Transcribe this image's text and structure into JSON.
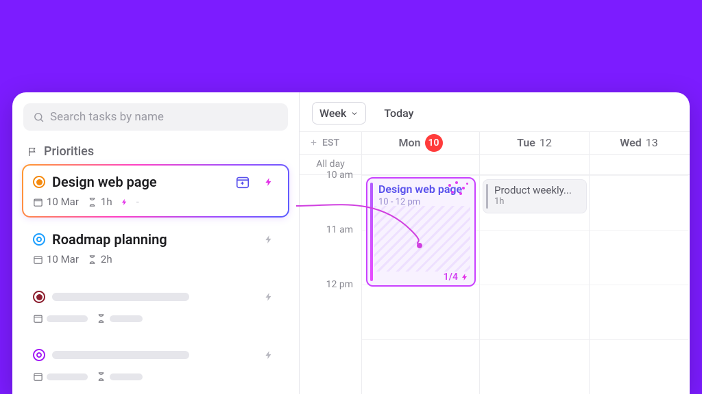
{
  "search": {
    "placeholder": "Search tasks by name"
  },
  "sidebar": {
    "section_title": "Priorities",
    "tasks": [
      {
        "title": "Design web page",
        "date": "10 Mar",
        "duration": "1h"
      },
      {
        "title": "Roadmap planning",
        "date": "10 Mar",
        "duration": "2h"
      }
    ]
  },
  "calendar": {
    "view_label": "Week",
    "today_label": "Today",
    "timezone": "EST",
    "allday_label": "All day",
    "days": [
      {
        "dow": "Mon",
        "num": "10",
        "today": true
      },
      {
        "dow": "Tue",
        "num": "12",
        "today": false
      },
      {
        "dow": "Wed",
        "num": "13",
        "today": false
      }
    ],
    "hours": [
      "10 am",
      "11 am",
      "12 pm"
    ],
    "events": {
      "design": {
        "title": "Design web page",
        "time": "10 - 12 pm",
        "progress": "1/4"
      },
      "product": {
        "title": "Product weekly...",
        "duration": "1h"
      }
    }
  },
  "colors": {
    "accent": "#7c1cff",
    "danger": "#ff3b3b",
    "magenta": "#e332e8",
    "indigo": "#5850ec"
  }
}
